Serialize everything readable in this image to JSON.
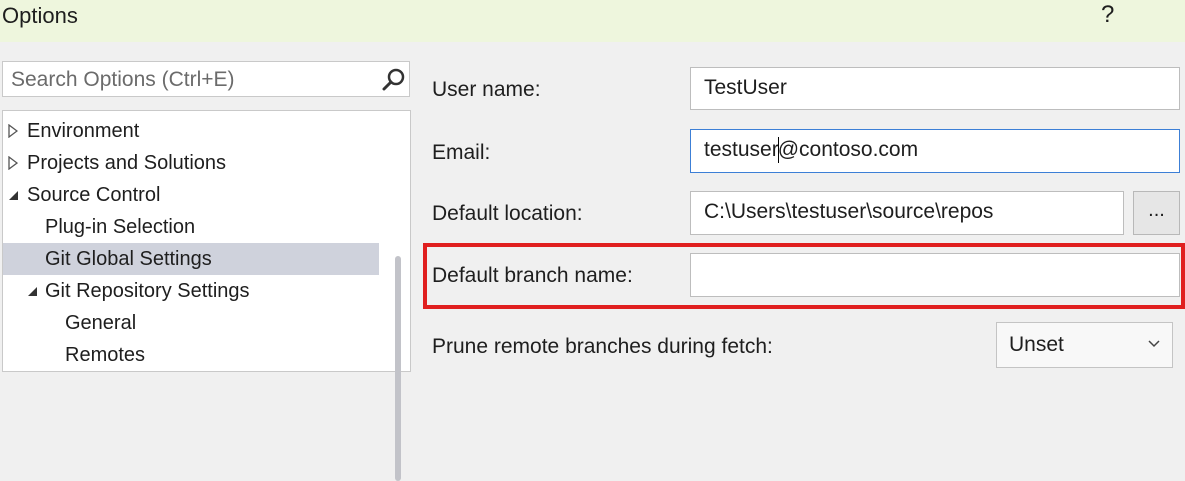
{
  "window": {
    "title": "Options",
    "help": "?"
  },
  "search": {
    "placeholder": "Search Options (Ctrl+E)"
  },
  "tree": {
    "items": [
      {
        "label": "Environment",
        "expander": "collapsed",
        "level": 0
      },
      {
        "label": "Projects and Solutions",
        "expander": "collapsed",
        "level": 0
      },
      {
        "label": "Source Control",
        "expander": "expanded",
        "level": 0
      },
      {
        "label": "Plug-in Selection",
        "expander": "none",
        "level": 1
      },
      {
        "label": "Git Global Settings",
        "expander": "none",
        "level": 1,
        "selected": true
      },
      {
        "label": "Git Repository Settings",
        "expander": "expanded",
        "level": 1
      },
      {
        "label": "General",
        "expander": "none",
        "level": 2
      },
      {
        "label": "Remotes",
        "expander": "none",
        "level": 2
      }
    ]
  },
  "settings": {
    "user_name": {
      "label": "User name:",
      "value": "TestUser"
    },
    "email": {
      "label": "Email:",
      "value_before_caret": "testuser",
      "value_after_caret": "@contoso.com"
    },
    "default_location": {
      "label": "Default location:",
      "value": "C:\\Users\\testuser\\source\\repos",
      "browse_label": "..."
    },
    "default_branch": {
      "label": "Default branch name:",
      "value": ""
    },
    "prune": {
      "label": "Prune remote branches during fetch:",
      "value": "Unset"
    }
  },
  "colors": {
    "highlight": "#e01f1f",
    "selected_row": "#cfd2dc",
    "focus_border": "#3c7fd6",
    "titlebar": "#eef6dd"
  },
  "icons": {
    "search": "search-icon",
    "collapsed": "triangle-right-icon",
    "expanded": "triangle-expanded-icon",
    "dropdown": "chevron-down-icon"
  }
}
